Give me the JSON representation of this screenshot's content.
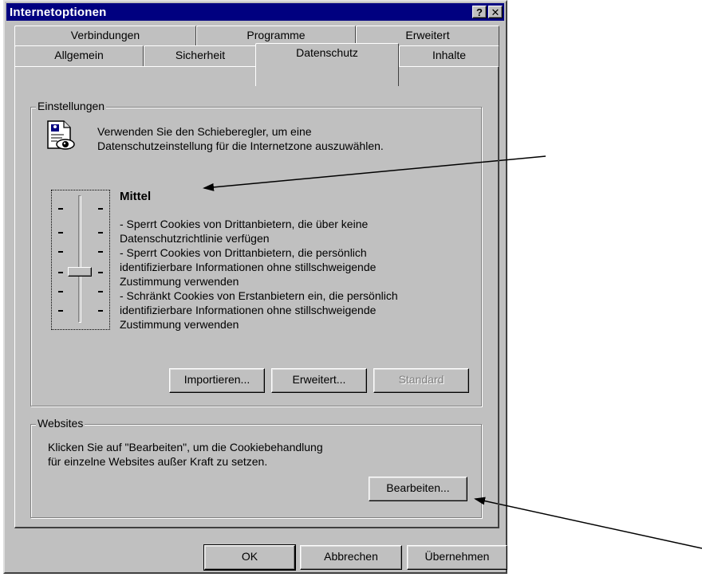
{
  "window": {
    "title": "Internetoptionen",
    "help_label": "?",
    "close_label": "✕"
  },
  "tabs_row_back": [
    {
      "label": "Verbindungen"
    },
    {
      "label": "Programme"
    },
    {
      "label": "Erweitert"
    }
  ],
  "tabs_row_front": [
    {
      "label": "Allgemein"
    },
    {
      "label": "Sicherheit"
    },
    {
      "label": "Datenschutz",
      "active": true
    },
    {
      "label": "Inhalte"
    }
  ],
  "settings_group": {
    "legend": "Einstellungen",
    "intro_line1": "Verwenden Sie den Schieberegler, um eine",
    "intro_line2": "Datenschutzeinstellung für die Internetzone auszuwählen.",
    "icon": "privacy-document-eye-icon",
    "level_title": "Mittel",
    "level_description": [
      "- Sperrt Cookies von Drittanbietern, die über keine",
      "Datenschutzrichtlinie verfügen",
      "- Sperrt Cookies von Drittanbietern, die persönlich",
      "identifizierbare Informationen ohne stillschweigende",
      "Zustimmung verwenden",
      "- Schränkt Cookies von Erstanbietern ein, die persönlich",
      "identifizierbare Informationen ohne stillschweigende",
      "Zustimmung verwenden"
    ],
    "slider_level": "Mittel",
    "buttons": {
      "import_label": "Importieren...",
      "advanced_label": "Erweitert...",
      "standard_label": "Standard"
    }
  },
  "websites_group": {
    "legend": "Websites",
    "text_line1": "Klicken Sie auf \"Bearbeiten\", um die Cookiebehandlung",
    "text_line2": "für einzelne Websites außer Kraft zu setzen.",
    "edit_label": "Bearbeiten..."
  },
  "footer": {
    "ok_label": "OK",
    "cancel_label": "Abbrechen",
    "apply_label": "Übernehmen"
  },
  "colors": {
    "dialog_face": "#c0c0c0",
    "titlebar": "#000080",
    "disabled_text": "#808080"
  }
}
